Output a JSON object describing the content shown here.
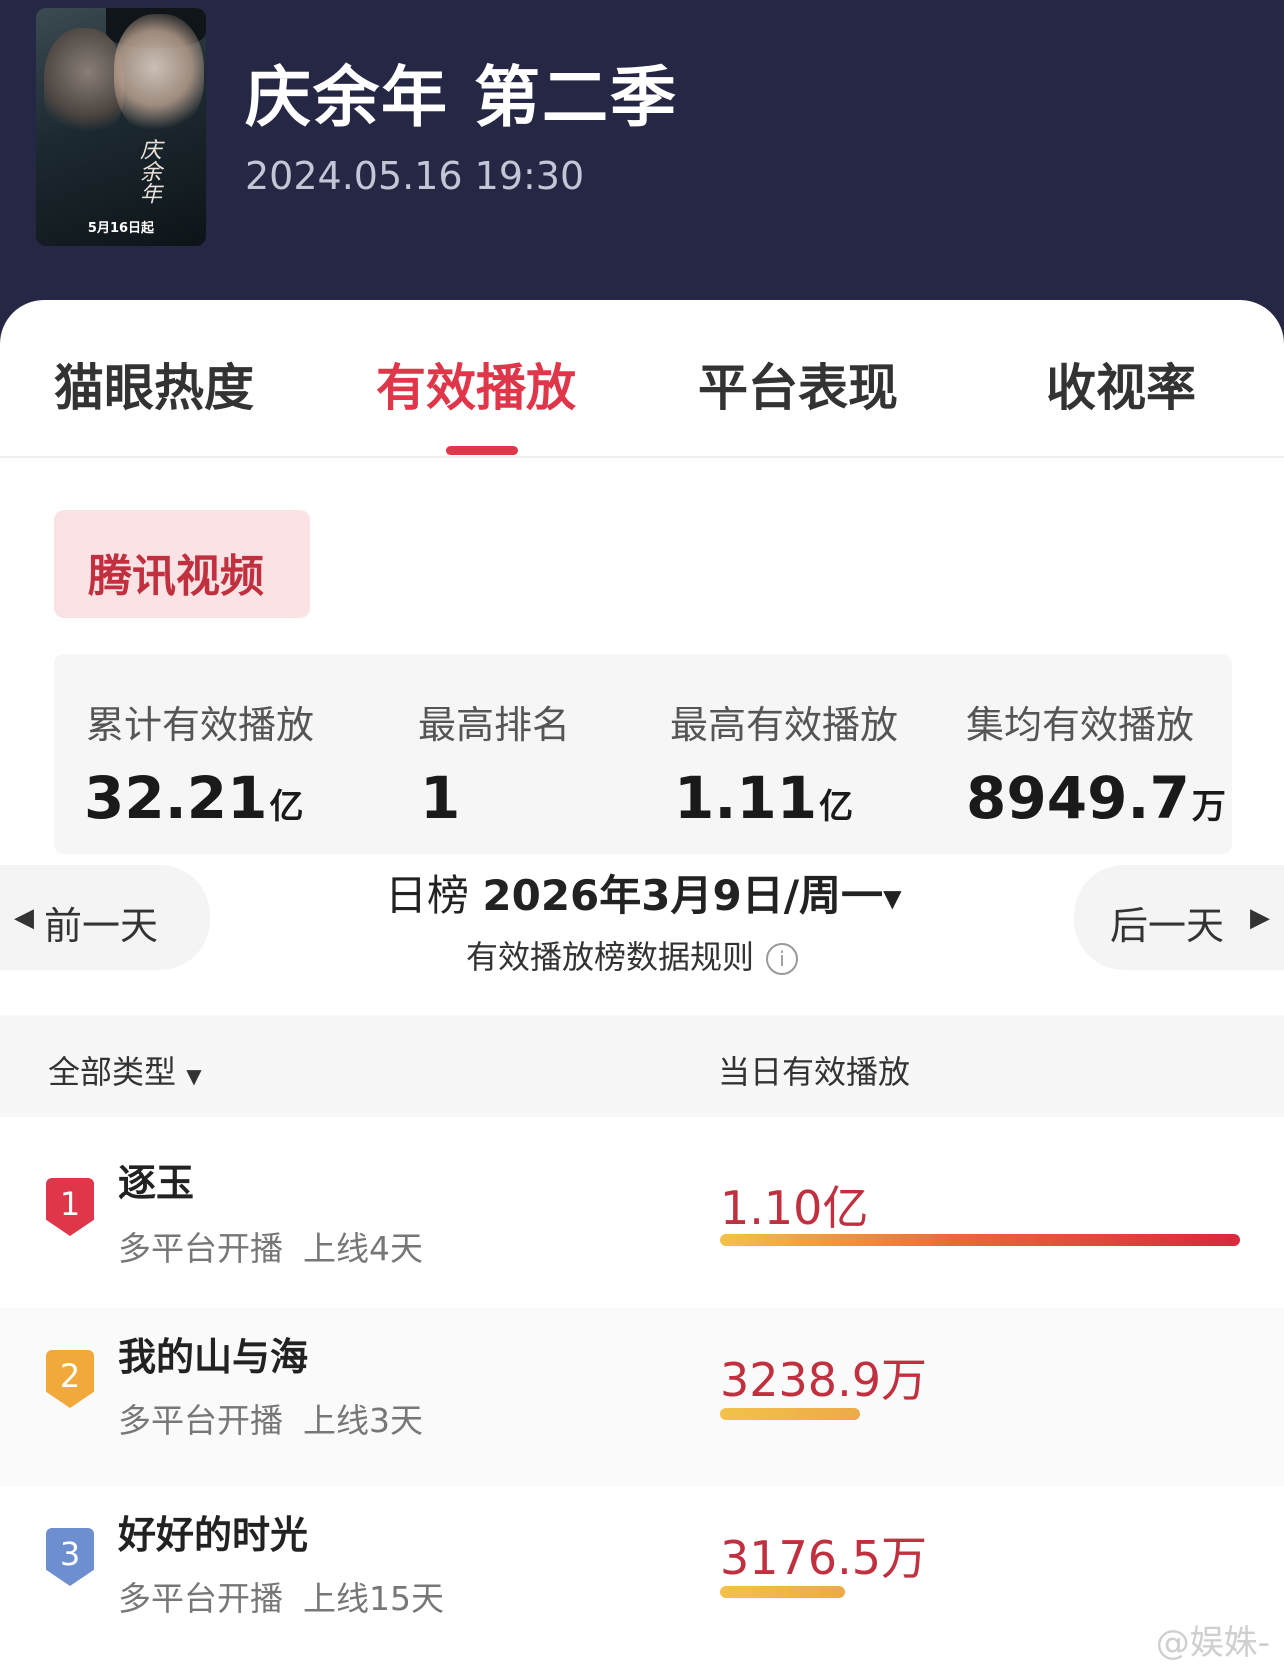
{
  "header": {
    "title": "庆余年 第二季",
    "datetime": "2024.05.16 19:30",
    "poster": {
      "calligraphy": "庆余年",
      "date_text": "5月16日起"
    }
  },
  "tabs": [
    {
      "label": "猫眼热度",
      "active": false
    },
    {
      "label": "有效播放",
      "active": true
    },
    {
      "label": "平台表现",
      "active": false
    },
    {
      "label": "收视率",
      "active": false
    }
  ],
  "platform": "腾讯视频",
  "stats": [
    {
      "label": "累计有效播放",
      "value": "32.21",
      "unit": "亿"
    },
    {
      "label": "最高排名",
      "value": "1",
      "unit": ""
    },
    {
      "label": "最高有效播放",
      "value": "1.11",
      "unit": "亿"
    },
    {
      "label": "集均有效播放",
      "value": "8949.7",
      "unit": "万"
    }
  ],
  "day_nav": {
    "prev": "前一天",
    "next": "后一天",
    "rank_type": "日榜",
    "date": "2026年3月9日/周一",
    "rule": "有效播放榜数据规则"
  },
  "list": {
    "type_filter": "全部类型",
    "column": "当日有效播放",
    "rows": [
      {
        "rank": "1",
        "name": "逐玉",
        "meta1": "多平台开播",
        "meta2": "上线4天",
        "value": "1.10亿",
        "fraction": 1.0
      },
      {
        "rank": "2",
        "name": "我的山与海",
        "meta1": "多平台开播",
        "meta2": "上线3天",
        "value": "3238.9万",
        "fraction": 0.27
      },
      {
        "rank": "3",
        "name": "好好的时光",
        "meta1": "多平台开播",
        "meta2": "上线15天",
        "value": "3176.5万",
        "fraction": 0.24
      }
    ]
  },
  "colors": {
    "accent": "#e0364a",
    "badge1": "#e0364a",
    "badge2": "#f2a93b",
    "badge3": "#6d8fd0"
  },
  "watermark": "@娱姝-"
}
